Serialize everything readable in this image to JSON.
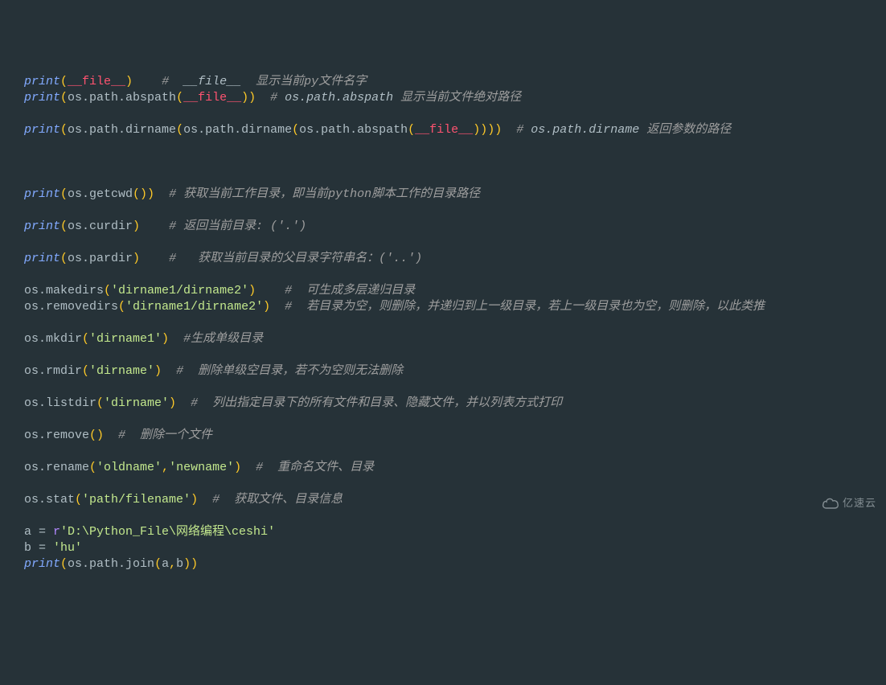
{
  "watermark": "亿速云",
  "colors": {
    "background": "#263238",
    "keyword": "#b388ff",
    "builtin": "#82aaff",
    "punctuation": "#ffca28",
    "identifier": "#b0bec5",
    "dunder_magic": "#ff5370",
    "string": "#c3e88d",
    "comment": "#9e9e9e"
  },
  "code_plain": [
    "print(__file__)    #  __file__  显示当前py文件名字",
    "print(os.path.abspath(__file__))  # os.path.abspath 显示当前文件绝对路径",
    "",
    "print(os.path.dirname(os.path.dirname(os.path.abspath(__file__))))  # os.path.dirname 返回参数的路径",
    "",
    "",
    "",
    "print(os.getcwd())  # 获取当前工作目录，即当前python脚本工作的目录路径",
    "",
    "print(os.curdir)    # 返回当前目录: ('.')",
    "",
    "print(os.pardir)    #   获取当前目录的父目录字符串名：('..')",
    "",
    "os.makedirs('dirname1/dirname2')    #  可生成多层递归目录",
    "os.removedirs('dirname1/dirname2')  #  若目录为空，则删除，并递归到上一级目录，若上一级目录也为空，则删除，以此类推",
    "",
    "os.mkdir('dirname1')  #生成单级目录",
    "",
    "os.rmdir('dirname')  #  删除单级空目录，若不为空则无法删除",
    "",
    "os.listdir('dirname')  #  列出指定目录下的所有文件和目录、隐藏文件，并以列表方式打印",
    "",
    "os.remove()  #  删除一个文件",
    "",
    "os.rename('oldname','newname')  #  重命名文件、目录",
    "",
    "os.stat('path/filename')  #  获取文件、目录信息",
    "",
    "a = r'D:\\Python_File\\网络编程\\ceshi'",
    "b = 'hu'",
    "print(os.path.join(a,b))"
  ],
  "lines": [
    [
      [
        "builtin",
        "print"
      ],
      [
        "punct",
        "("
      ],
      [
        "dunder",
        "__file__"
      ],
      [
        "punct",
        ")"
      ],
      [
        "ident",
        "    "
      ],
      [
        "comment",
        "#  "
      ],
      [
        "comment-bold",
        "__file__"
      ],
      [
        "comment",
        "  显示当前py文件名字"
      ]
    ],
    [
      [
        "builtin",
        "print"
      ],
      [
        "punct",
        "("
      ],
      [
        "ident",
        "os.path.abspath"
      ],
      [
        "punct",
        "("
      ],
      [
        "dunder",
        "__file__"
      ],
      [
        "punct",
        "))"
      ],
      [
        "ident",
        "  "
      ],
      [
        "comment",
        "# "
      ],
      [
        "comment-bold",
        "os.path.abspath "
      ],
      [
        "comment",
        "显示当前文件绝对路径"
      ]
    ],
    [],
    [
      [
        "builtin",
        "print"
      ],
      [
        "punct",
        "("
      ],
      [
        "ident",
        "os.path.dirname"
      ],
      [
        "punct",
        "("
      ],
      [
        "ident",
        "os.path.dirname"
      ],
      [
        "punct",
        "("
      ],
      [
        "ident",
        "os.path.abspath"
      ],
      [
        "punct",
        "("
      ],
      [
        "dunder",
        "__file__"
      ],
      [
        "punct",
        "))))"
      ],
      [
        "ident",
        "  "
      ],
      [
        "comment",
        "# "
      ],
      [
        "comment-bold",
        "os.path.dirname "
      ],
      [
        "comment",
        "返回参数的路径"
      ]
    ],
    [],
    [],
    [],
    [
      [
        "builtin",
        "print"
      ],
      [
        "punct",
        "("
      ],
      [
        "ident",
        "os.getcwd"
      ],
      [
        "punct",
        "())"
      ],
      [
        "ident",
        "  "
      ],
      [
        "comment",
        "# 获取当前工作目录，即当前python脚本工作的目录路径"
      ]
    ],
    [],
    [
      [
        "builtin",
        "print"
      ],
      [
        "punct",
        "("
      ],
      [
        "ident",
        "os.curdir"
      ],
      [
        "punct",
        ")"
      ],
      [
        "ident",
        "    "
      ],
      [
        "comment",
        "# 返回当前目录: ('.')"
      ]
    ],
    [],
    [
      [
        "builtin",
        "print"
      ],
      [
        "punct",
        "("
      ],
      [
        "ident",
        "os.pardir"
      ],
      [
        "punct",
        ")"
      ],
      [
        "ident",
        "    "
      ],
      [
        "comment",
        "#   获取当前目录的父目录字符串名：('..')"
      ]
    ],
    [],
    [
      [
        "ident",
        "os.makedirs"
      ],
      [
        "punct",
        "("
      ],
      [
        "string",
        "'dirname1/dirname2'"
      ],
      [
        "punct",
        ")"
      ],
      [
        "ident",
        "    "
      ],
      [
        "comment",
        "#  可生成多层递归目录"
      ]
    ],
    [
      [
        "ident",
        "os.removedirs"
      ],
      [
        "punct",
        "("
      ],
      [
        "string",
        "'dirname1/dirname2'"
      ],
      [
        "punct",
        ")"
      ],
      [
        "ident",
        "  "
      ],
      [
        "comment",
        "#  若目录为空，则删除，并递归到上一级目录，若上一级目录也为空，则删除，以此类推"
      ]
    ],
    [],
    [
      [
        "ident",
        "os.mkdir"
      ],
      [
        "punct",
        "("
      ],
      [
        "string",
        "'dirname1'"
      ],
      [
        "punct",
        ")"
      ],
      [
        "ident",
        "  "
      ],
      [
        "comment",
        "#生成单级目录"
      ]
    ],
    [],
    [
      [
        "ident",
        "os.rmdir"
      ],
      [
        "punct",
        "("
      ],
      [
        "string",
        "'dirname'"
      ],
      [
        "punct",
        ")"
      ],
      [
        "ident",
        "  "
      ],
      [
        "comment",
        "#  删除单级空目录，若不为空则无法删除"
      ]
    ],
    [],
    [
      [
        "ident",
        "os.listdir"
      ],
      [
        "punct",
        "("
      ],
      [
        "string",
        "'dirname'"
      ],
      [
        "punct",
        ")"
      ],
      [
        "ident",
        "  "
      ],
      [
        "comment",
        "#  列出指定目录下的所有文件和目录、隐藏文件，并以列表方式打印"
      ]
    ],
    [],
    [
      [
        "ident",
        "os.remove"
      ],
      [
        "punct",
        "()"
      ],
      [
        "ident",
        "  "
      ],
      [
        "comment",
        "#  删除一个文件"
      ]
    ],
    [],
    [
      [
        "ident",
        "os.rename"
      ],
      [
        "punct",
        "("
      ],
      [
        "string",
        "'oldname'"
      ],
      [
        "punct",
        ","
      ],
      [
        "string",
        "'newname'"
      ],
      [
        "punct",
        ")"
      ],
      [
        "ident",
        "  "
      ],
      [
        "comment",
        "#  重命名文件、目录"
      ]
    ],
    [],
    [
      [
        "ident",
        "os.stat"
      ],
      [
        "punct",
        "("
      ],
      [
        "string",
        "'path/filename'"
      ],
      [
        "punct",
        ")"
      ],
      [
        "ident",
        "  "
      ],
      [
        "comment",
        "#  获取文件、目录信息"
      ]
    ],
    [],
    [
      [
        "ident",
        "a = "
      ],
      [
        "prefix",
        "r"
      ],
      [
        "string",
        "'D:\\Python_File\\网络编程\\ceshi'"
      ]
    ],
    [
      [
        "ident",
        "b = "
      ],
      [
        "string",
        "'hu'"
      ]
    ],
    [
      [
        "builtin",
        "print"
      ],
      [
        "punct",
        "("
      ],
      [
        "ident",
        "os.path.join"
      ],
      [
        "punct",
        "("
      ],
      [
        "ident",
        "a"
      ],
      [
        "punct",
        ","
      ],
      [
        "ident",
        "b"
      ],
      [
        "punct",
        "))"
      ]
    ]
  ]
}
